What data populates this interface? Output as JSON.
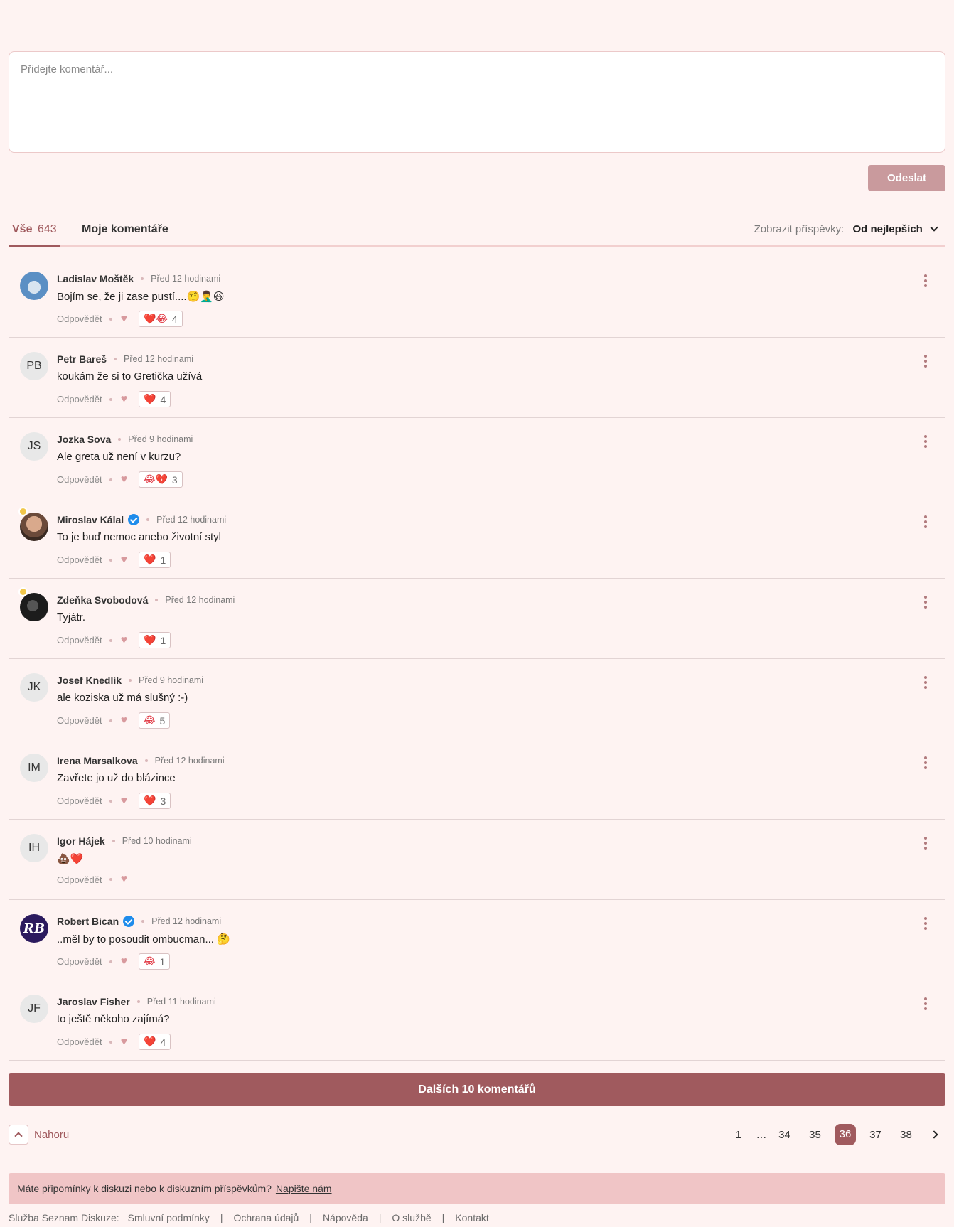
{
  "compose": {
    "placeholder": "Přidejte komentář...",
    "send_label": "Odeslat"
  },
  "tabs": {
    "all_label": "Vše",
    "all_count": "643",
    "mine_label": "Moje komentáře",
    "sort_label": "Zobrazit příspěvky:",
    "sort_value": "Od nejlepších"
  },
  "comment_actions": {
    "reply_label": "Odpovědět"
  },
  "comments": [
    {
      "author": "Ladislav Moštěk",
      "time": "Před 12 hodinami",
      "text": "Bojím se, že ji zase pustí....🤨🤦‍♂️😆",
      "reactions": "❤️😂",
      "count": "4",
      "avatar": "photo-blue",
      "initials": "",
      "verified": false,
      "crown": false
    },
    {
      "author": "Petr Bareš",
      "time": "Před 12 hodinami",
      "text": "koukám že si to Gretička užívá",
      "reactions": "❤️",
      "count": "4",
      "avatar": "initials",
      "initials": "PB",
      "verified": false,
      "crown": false
    },
    {
      "author": "Jozka Sova",
      "time": "Před 9 hodinami",
      "text": "Ale greta už není v kurzu?",
      "reactions": "😂💔",
      "count": "3",
      "avatar": "initials",
      "initials": "JS",
      "verified": false,
      "crown": false
    },
    {
      "author": "Miroslav Kálal",
      "time": "Před 12 hodinami",
      "text": "To je buď nemoc anebo životní styl",
      "reactions": "❤️",
      "count": "1",
      "avatar": "photo-face",
      "initials": "",
      "verified": true,
      "crown": true
    },
    {
      "author": "Zdeňka Svobodová",
      "time": "Před 12 hodinami",
      "text": "Tyjátr.",
      "reactions": "❤️",
      "count": "1",
      "avatar": "photo-dark",
      "initials": "",
      "verified": false,
      "crown": true
    },
    {
      "author": "Josef Knedlík",
      "time": "Před 9 hodinami",
      "text": "ale koziska už má slušný :-)",
      "reactions": "😂",
      "count": "5",
      "avatar": "initials",
      "initials": "JK",
      "verified": false,
      "crown": false
    },
    {
      "author": "Irena Marsalkova",
      "time": "Před 12 hodinami",
      "text": "Zavřete jo už do blázince",
      "reactions": "❤️",
      "count": "3",
      "avatar": "initials",
      "initials": "IM",
      "verified": false,
      "crown": false
    },
    {
      "author": "Igor Hájek",
      "time": "Před 10 hodinami",
      "text": "💩❤️",
      "reactions": "",
      "count": "",
      "avatar": "initials",
      "initials": "IH",
      "verified": false,
      "crown": false
    },
    {
      "author": "Robert Bican",
      "time": "Před 12 hodinami",
      "text": "..měl by to posoudit ombucman... 🤔",
      "reactions": "😂",
      "count": "1",
      "avatar": "photo-rb",
      "initials": "RB",
      "verified": true,
      "crown": false
    },
    {
      "author": "Jaroslav Fisher",
      "time": "Před 11 hodinami",
      "text": "to ještě někoho zajímá?",
      "reactions": "❤️",
      "count": "4",
      "avatar": "initials",
      "initials": "JF",
      "verified": false,
      "crown": false
    }
  ],
  "load_more_label": "Dalších 10 komentářů",
  "top_link_label": "Nahoru",
  "pagination": {
    "pages": [
      "1",
      "…",
      "34",
      "35",
      "36",
      "37",
      "38"
    ],
    "current": "36"
  },
  "feedback": {
    "text": "Máte připomínky k diskuzi nebo k diskuzním příspěvkům?",
    "link": "Napište nám"
  },
  "footer": {
    "label": "Služba Seznam Diskuze:",
    "links": [
      "Smluvní podmínky",
      "Ochrana údajů",
      "Nápověda",
      "O službě",
      "Kontakt"
    ]
  },
  "colors": {
    "accent": "#a05a5e",
    "background": "#fef3f2",
    "send_button": "#c99a9d",
    "feedback_bg": "#f0c5c6"
  }
}
